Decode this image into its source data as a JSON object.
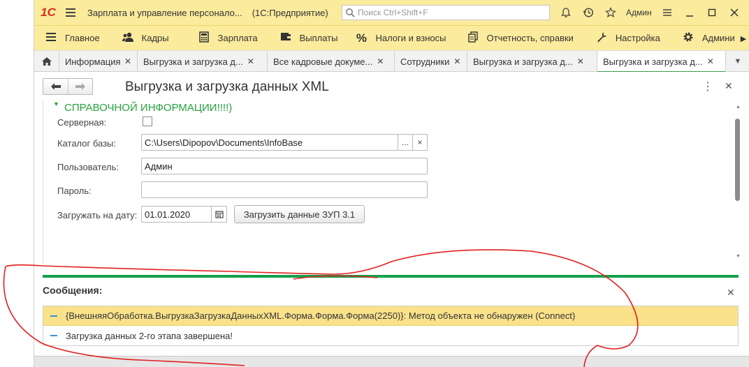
{
  "window": {
    "logo": "1С",
    "app_title": "Зарплата и управление персонало...",
    "app_subtitle": "(1С:Предприятие)",
    "search_placeholder": "Поиск Ctrl+Shift+F",
    "user": "Админ"
  },
  "menu": {
    "items": [
      {
        "label": "Главное",
        "icon": "hamburger-icon"
      },
      {
        "label": "Кадры",
        "icon": "people-icon"
      },
      {
        "label": "Зарплата",
        "icon": "calculator-icon"
      },
      {
        "label": "Выплаты",
        "icon": "wallet-icon"
      },
      {
        "label": "Налоги и взносы",
        "icon": "percent-icon"
      },
      {
        "label": "Отчетность, справки",
        "icon": "documents-icon"
      },
      {
        "label": "Настройка",
        "icon": "wrench-icon"
      },
      {
        "label": "Админи",
        "icon": "gear-icon"
      }
    ]
  },
  "tabs": [
    {
      "label": "Информация"
    },
    {
      "label": "Выгрузка и загрузка д..."
    },
    {
      "label": "Все кадровые докуме..."
    },
    {
      "label": "Сотрудники"
    },
    {
      "label": "Выгрузка и загрузка д..."
    },
    {
      "label": "Выгрузка и загрузка д...",
      "active": true
    }
  ],
  "form": {
    "title": "Выгрузка и загрузка данных XML",
    "group_caption": "СПРАВОЧНОЙ ИНФОРМАЦИИ!!!!)",
    "server_label": "Серверная:",
    "server_checked": false,
    "catalog_label": "Каталог базы:",
    "catalog_value": "C:\\Users\\Dipopov\\Documents\\InfoBase",
    "catalog_select_btn": "...",
    "catalog_clear_btn": "×",
    "user_label": "Пользователь:",
    "user_value": "Админ",
    "password_label": "Пароль:",
    "password_value": "",
    "date_label": "Загружать на дату:",
    "date_value": "01.01.2020",
    "load_button": "Загрузить данные ЗУП 3.1"
  },
  "messages": {
    "title": "Сообщения:",
    "items": [
      {
        "text": "{ВнешняяОбработка.ВыгрузкаЗагрузкаДанныхXML.Форма.Форма.Форма(2250)}: Метод объекта не обнаружен (Connect)",
        "selected": true
      },
      {
        "text": "Загрузка данных 2-го этапа завершена!",
        "selected": false
      }
    ]
  },
  "colors": {
    "titlebar": "#fbeb9c",
    "accent_green": "#14a04a",
    "selected_message": "#fae28b",
    "annotation_red": "#e02020"
  }
}
